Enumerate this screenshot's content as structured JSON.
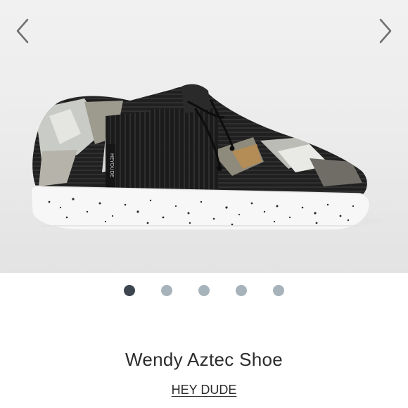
{
  "product": {
    "title": "Wendy Aztec Shoe",
    "brand": "HEY DUDE",
    "image_alt_icon": "shoe-product-image",
    "shoe_tag_text": "HEYDUDE"
  },
  "gallery": {
    "prev_icon": "chevron-left-icon",
    "next_icon": "chevron-right-icon",
    "dot_count": 5,
    "active_index": 0
  },
  "colors": {
    "active_dot": "#3d4650",
    "inactive_dot": "#a7b3bb",
    "text": "#2c2c2c",
    "sole": "#f7f7f7",
    "upper_dark": "#1f1f1f"
  }
}
